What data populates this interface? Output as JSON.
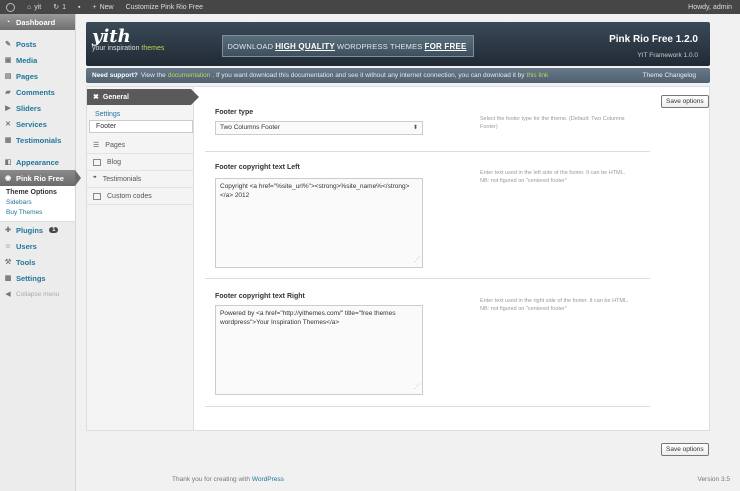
{
  "admin_bar": {
    "site_name": "yit",
    "updates_count": "1",
    "new_label": "New",
    "customize_label": "Customize Pink Rio Free",
    "howdy": "Howdy, admin"
  },
  "sidebar": {
    "dashboard": "Dashboard",
    "posts": "Posts",
    "media": "Media",
    "pages": "Pages",
    "comments": "Comments",
    "sliders": "Sliders",
    "services": "Services",
    "testimonials": "Testimonials",
    "appearance": "Appearance",
    "pink_rio": "Pink Rio Free",
    "sub_theme_options": "Theme Options",
    "sub_sidebars": "Sidebars",
    "sub_buy_themes": "Buy Themes",
    "plugins": "Plugins",
    "plugins_badge": "1",
    "users": "Users",
    "tools": "Tools",
    "settings": "Settings",
    "collapse": "Collapse menu"
  },
  "banner": {
    "logo": "yith",
    "tagline_prefix": "your inspiration",
    "tagline_highlight": "themes",
    "download_pre": "DOWNLOAD",
    "download_hq": "HIGH QUALITY",
    "download_mid": "WORDPRESS THEMES",
    "download_free": "FOR FREE",
    "theme_version": "Pink Rio Free 1.2.0",
    "framework": "YIT Framework 1.0.0"
  },
  "support": {
    "label": "Need support?",
    "text1": "View the",
    "doc_link": "documentation",
    "text2": ". If you want download this documentation and see it without any internet connection, you can download it by",
    "this_link": "this link",
    "changelog": "Theme Changelog"
  },
  "leftnav": {
    "general": "General",
    "settings": "Settings",
    "footer": "Footer",
    "pages": "Pages",
    "blog": "Blog",
    "testimonials": "Testimonials",
    "custom_codes": "Custom codes"
  },
  "options": {
    "save_label": "Save options",
    "footer_type_label": "Footer type",
    "footer_type_value": "Two Columns Footer",
    "footer_type_desc": "Select the footer type for the theme. (Default: Two Columns Footer)",
    "left_label": "Footer copyright text Left",
    "left_value": "Copyright <a href=\"%site_url%\"><strong>%site_name%</strong></a> 2012",
    "left_desc": "Enter text used in the left side of the footer. It can be HTML. NB: not figured on \"centered footer\"",
    "right_label": "Footer copyright text Right",
    "right_value": "Powered by <a href=\"http://yithemes.com/\" title=\"free themes wordpress\">Your Inspiration Themes</a>",
    "right_desc": "Enter text used in the right side of the footer. It can be HTML. NB: not figured on \"centered footer\""
  },
  "footer": {
    "thanks": "Thank you for creating with",
    "wp_link": "WordPress",
    "version": "Version 3.5"
  }
}
